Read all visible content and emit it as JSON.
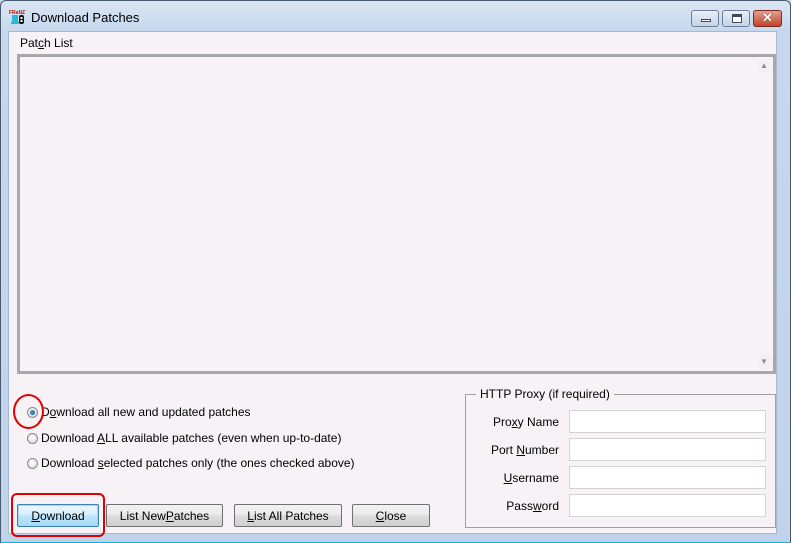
{
  "window": {
    "title": "Download Patches",
    "app_icon": "franz-app-icon",
    "caption_buttons": {
      "minimize": "minimize-icon",
      "maximize": "maximize-icon",
      "close": "close-icon",
      "close_glyph": "✕"
    }
  },
  "patch_list": {
    "label_pre": "Pat",
    "label_mnemonic": "c",
    "label_mid": "h",
    "label_post": " List",
    "items": [],
    "scroll_up_glyph": "▲",
    "scroll_down_glyph": "▼"
  },
  "download_options": [
    {
      "pre": "D",
      "mnemonic": "o",
      "post": "wnload all new and updated patches",
      "checked": true
    },
    {
      "pre": "Download ",
      "mnemonic": "A",
      "post": "LL available patches (even when up-to-date)",
      "checked": false
    },
    {
      "pre": "Download ",
      "mnemonic": "s",
      "post": "elected patches only (the ones checked above)",
      "checked": false
    }
  ],
  "buttons": {
    "download": {
      "pre": "",
      "mnemonic": "D",
      "post": "ownload"
    },
    "list_new": {
      "pre": "List New ",
      "mnemonic": "P",
      "post": "atches"
    },
    "list_all": {
      "pre": "",
      "mnemonic": "L",
      "post": "ist All Patches"
    },
    "close": {
      "pre": "",
      "mnemonic": "C",
      "post": "lose"
    }
  },
  "proxy": {
    "legend": "HTTP Proxy (if required)",
    "fields": [
      {
        "pre": "Pro",
        "mnemonic": "x",
        "post": "y Name",
        "value": ""
      },
      {
        "pre": "Port ",
        "mnemonic": "N",
        "post": "umber",
        "value": ""
      },
      {
        "pre": "",
        "mnemonic": "U",
        "post": "sername",
        "value": ""
      },
      {
        "pre": "Pass",
        "mnemonic": "w",
        "post": "ord",
        "value": ""
      }
    ]
  },
  "annotations": {
    "highlight_color": "#e00000",
    "highlighted": [
      "download-option-new-radio",
      "download-button"
    ]
  }
}
